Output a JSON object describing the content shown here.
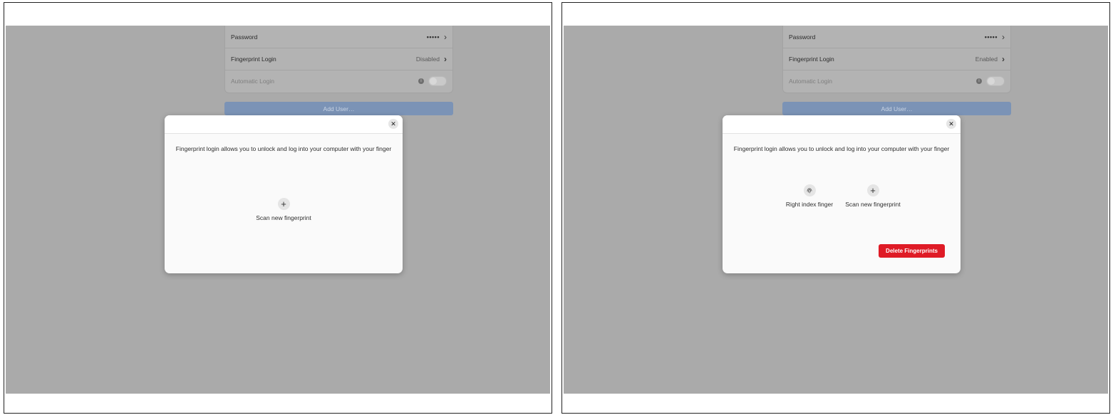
{
  "panels": [
    {
      "settings": {
        "password_label": "Password",
        "password_value": "•••••",
        "fingerprint_label": "Fingerprint Login",
        "fingerprint_status": "Disabled",
        "autologin_label": "Automatic Login"
      },
      "add_user_label": "Add User…",
      "dialog": {
        "description": "Fingerprint login allows you to unlock and log into your computer with your finger",
        "scan_label": "Scan new fingerprint"
      }
    },
    {
      "settings": {
        "password_label": "Password",
        "password_value": "•••••",
        "fingerprint_label": "Fingerprint Login",
        "fingerprint_status": "Enabled",
        "autologin_label": "Automatic Login"
      },
      "add_user_label": "Add User…",
      "dialog": {
        "description": "Fingerprint login allows you to unlock and log into your computer with your finger",
        "enrolled_finger_label": "Right index finger",
        "scan_label": "Scan new fingerprint",
        "delete_label": "Delete Fingerprints"
      }
    }
  ],
  "colors": {
    "overlay": "#aaaaaa",
    "accent_blue": "#7b93b6",
    "destructive_red": "#df1b26"
  },
  "icons": {
    "close": "close-icon",
    "add": "plus-icon",
    "fingerprint": "fingerprint-icon",
    "chevron": "chevron-right-icon",
    "info": "info-icon"
  }
}
